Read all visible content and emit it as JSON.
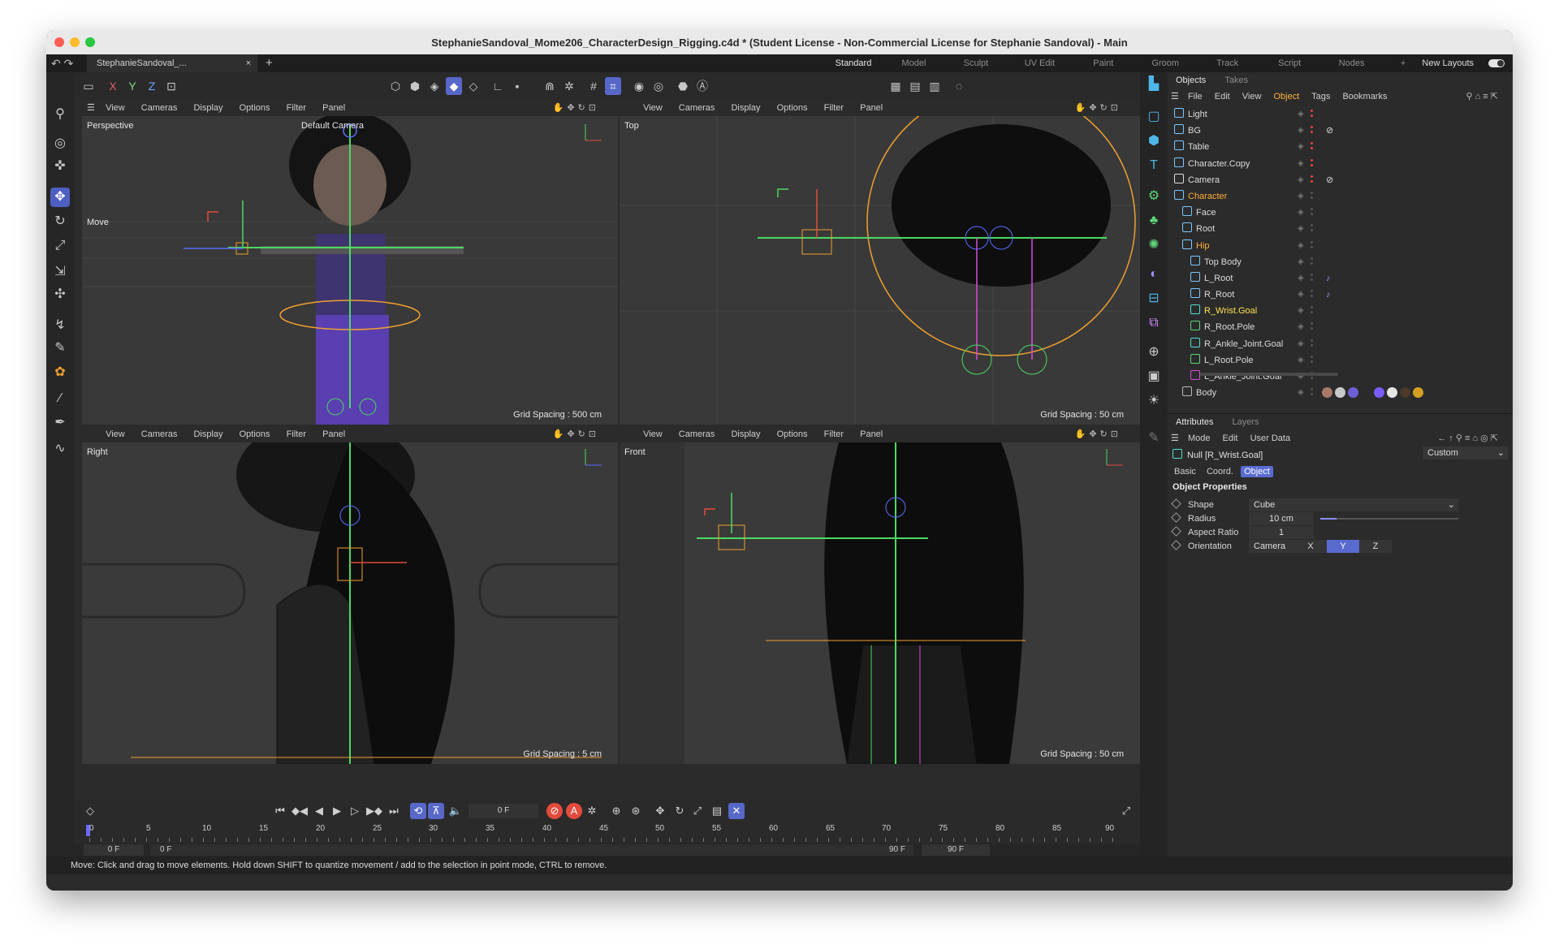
{
  "window": {
    "title": "StephanieSandoval_Mome206_CharacterDesign_Rigging.c4d * (Student License - Non-Commercial License for Stephanie Sandoval) - Main",
    "doc_tab": "StephanieSandoval_...",
    "doc_close": "×",
    "new_tab": "+"
  },
  "layouts": {
    "items": [
      "Standard",
      "Model",
      "Sculpt",
      "UV Edit",
      "Paint",
      "Groom",
      "Track",
      "Script",
      "Nodes",
      "+"
    ],
    "active": "Standard",
    "new_layouts": "New Layouts"
  },
  "toolbar": {
    "axis": [
      "X",
      "Y",
      "Z"
    ]
  },
  "viewports": {
    "menu": [
      "View",
      "Cameras",
      "Display",
      "Options",
      "Filter",
      "Panel"
    ],
    "perspective": {
      "name": "Perspective",
      "camera": "Default Camera",
      "tool": "Move",
      "grid": "Grid Spacing : 500 cm"
    },
    "top": {
      "name": "Top",
      "grid": "Grid Spacing : 50 cm"
    },
    "right": {
      "name": "Right",
      "grid": "Grid Spacing : 5 cm"
    },
    "front": {
      "name": "Front",
      "grid": "Grid Spacing : 50 cm"
    }
  },
  "objects_panel": {
    "tabs": [
      "Objects",
      "Takes"
    ],
    "menu": [
      "File",
      "Edit",
      "View",
      "Object",
      "Tags",
      "Bookmarks"
    ],
    "active_menu": "Object",
    "items": [
      {
        "name": "Light",
        "color": "normal"
      },
      {
        "name": "BG",
        "color": "normal"
      },
      {
        "name": "Table",
        "color": "normal"
      },
      {
        "name": "Character.Copy",
        "color": "normal"
      },
      {
        "name": "Camera",
        "color": "normal"
      },
      {
        "name": "Character",
        "color": "orange"
      },
      {
        "name": "Face",
        "color": "normal"
      },
      {
        "name": "Root",
        "color": "normal"
      },
      {
        "name": "Hip",
        "color": "orange"
      },
      {
        "name": "Top Body",
        "color": "normal"
      },
      {
        "name": "L_Root",
        "color": "normal"
      },
      {
        "name": "R_Root",
        "color": "normal"
      },
      {
        "name": "R_Wrist.Goal",
        "color": "yellow"
      },
      {
        "name": "R_Root.Pole",
        "color": "normal"
      },
      {
        "name": "R_Ankle_Joint.Goal",
        "color": "normal"
      },
      {
        "name": "L_Root.Pole",
        "color": "normal"
      },
      {
        "name": "L_Ankle_Joint.Goal",
        "color": "normal"
      },
      {
        "name": "Body",
        "color": "normal"
      }
    ]
  },
  "attributes_panel": {
    "tabs": [
      "Attributes",
      "Layers"
    ],
    "menu": [
      "Mode",
      "Edit",
      "User Data"
    ],
    "object_title": "Null [R_Wrist.Goal]",
    "preset": "Custom",
    "subtabs": [
      "Basic",
      "Coord.",
      "Object"
    ],
    "active_subtab": "Object",
    "section": "Object Properties",
    "props": {
      "shape_label": "Shape",
      "shape_value": "Cube",
      "radius_label": "Radius",
      "radius_value": "10 cm",
      "aspect_label": "Aspect Ratio",
      "aspect_value": "1",
      "orient_label": "Orientation",
      "orient_value": "Camera",
      "orient_axes": [
        "X",
        "Y",
        "Z"
      ],
      "orient_active": "Y"
    }
  },
  "timeline": {
    "current_frame": "0 F",
    "ticks": [
      "0",
      "5",
      "10",
      "15",
      "20",
      "25",
      "30",
      "35",
      "40",
      "45",
      "50",
      "55",
      "60",
      "65",
      "70",
      "75",
      "80",
      "85",
      "90"
    ],
    "range_start": "0 F",
    "range_start2": "0 F",
    "range_end": "90 F",
    "range_end2": "90 F"
  },
  "status_bar": "Move: Click and drag to move elements. Hold down SHIFT to quantize movement / add to the selection in point mode, CTRL to remove.",
  "colors": {
    "accent": "#5868c8",
    "object_orange": "#ffae3a",
    "selected_yellow": "#ffe34d",
    "joint_green": "#4cd964",
    "controller_orange": "#f0a030"
  }
}
